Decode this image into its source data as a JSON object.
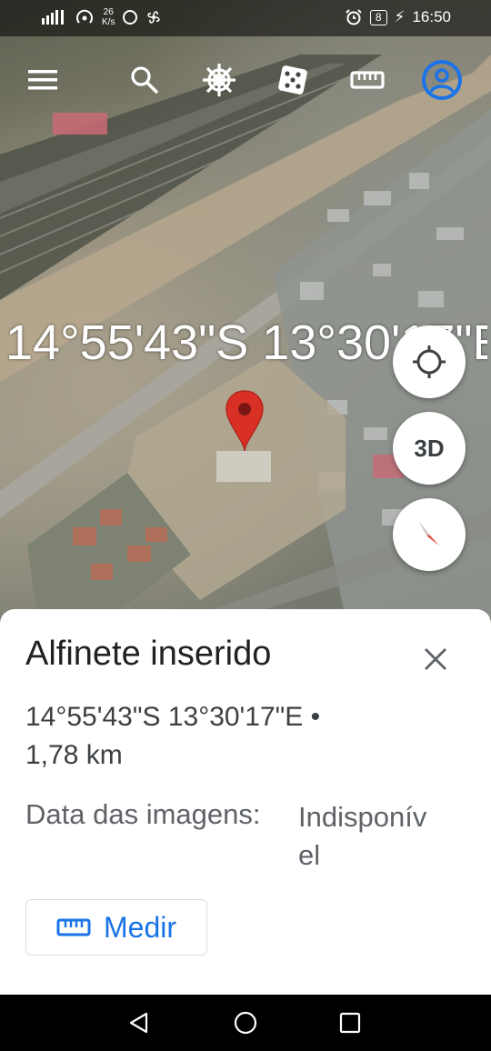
{
  "status_bar": {
    "net_speed_value": "26",
    "net_speed_unit": "K/s",
    "battery": "8",
    "time": "16:50"
  },
  "toolbar": {
    "items": [
      "menu-icon",
      "search-icon",
      "voyager-wheel-icon",
      "dice-icon",
      "ruler-icon",
      "account-icon"
    ],
    "account_color": "#1a73e8"
  },
  "map": {
    "coordinate_overlay": "14°55'43\"S 13°30'17\"E",
    "pin_color": "#d93025"
  },
  "fabs": {
    "three_d_label": "3D"
  },
  "sheet": {
    "title": "Alfinete inserido",
    "coordinates": "14°55'43\"S 13°30'17\"E  •",
    "distance": "1,78 km",
    "imagery_label": "Data das imagens:",
    "imagery_value": "Indisponível",
    "measure_label": "Medir",
    "accent": "#1a73e8"
  },
  "nav": {
    "items": [
      "back-icon",
      "home-icon",
      "recents-icon"
    ]
  }
}
